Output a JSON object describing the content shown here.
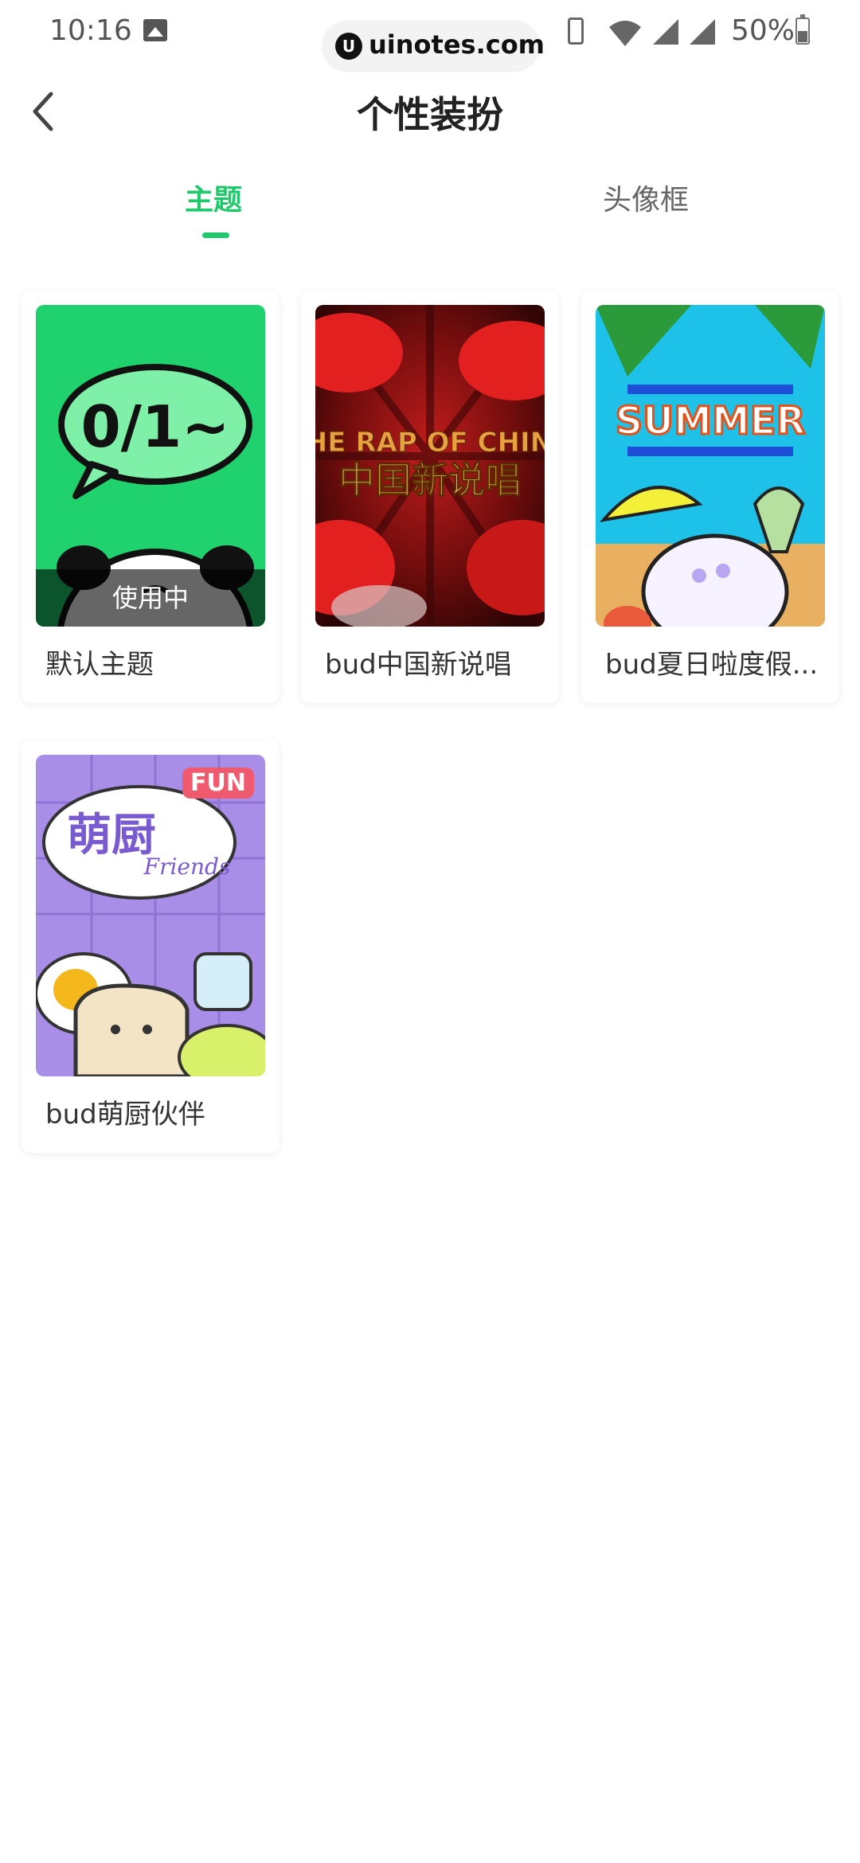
{
  "status_bar": {
    "time": "10:16",
    "url": "uinotes.com",
    "battery": "50%"
  },
  "header": {
    "title": "个性装扮"
  },
  "tabs": [
    {
      "label": "主题",
      "active": true
    },
    {
      "label": "头像框",
      "active": false
    }
  ],
  "themes": [
    {
      "title": "默认主题",
      "badge": "使用中",
      "bubble_text": "0/1~"
    },
    {
      "title": "bud中国新说唱",
      "art_line1": "THE RAP OF CHINA",
      "art_line2": "中国新说唱"
    },
    {
      "title": "bud夏日啦度假...",
      "art_text": "SUMMER"
    },
    {
      "title": "bud萌厨伙伴",
      "badge": "FUN",
      "art_text": "萌厨",
      "art_sub": "Friends"
    }
  ],
  "colors": {
    "accent": "#1fc86b",
    "default_theme_bg": "#1fd26e",
    "rap_bg": "#7a0f0f",
    "summer_sky": "#1ec2e8",
    "chef_bg": "#a98ee8"
  }
}
